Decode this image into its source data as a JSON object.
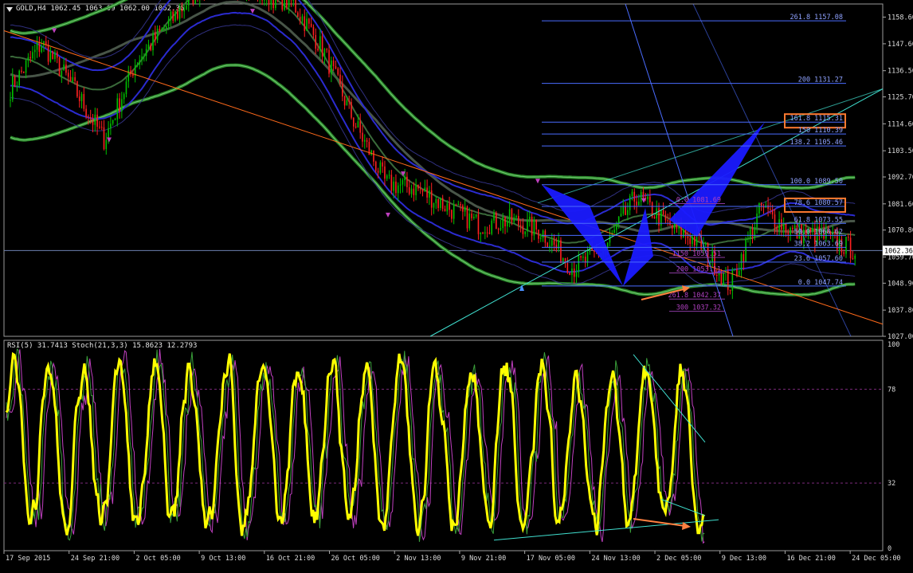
{
  "main_panel": {
    "symbol_header": "GOLD,H4  1062.45 1063.09 1062.00 1062.36",
    "current_price_label": "1062.36",
    "colors": {
      "background": "#000000",
      "bull_candle": "#00c000",
      "bear_candle": "#ff2020",
      "trendline": "#ff6a1a",
      "channel": "#40e0d0",
      "fib": "#4a6cff",
      "pattern": "#1a1aff",
      "ma_outer": "#2a8a2a",
      "band": "#4040ff"
    }
  },
  "fib_levels_upper": [
    {
      "label": "261.8  1157.08",
      "price": 1157.08
    },
    {
      "label": "200  1131.27",
      "price": 1131.27
    },
    {
      "label": "161.8  1115.31",
      "price": 1115.31,
      "highlight": true
    },
    {
      "label": "150  1110.39",
      "price": 1110.39
    },
    {
      "label": "138.2  1105.46",
      "price": 1105.46
    },
    {
      "label": "100.0  1089.50",
      "price": 1089.5
    },
    {
      "label": "78.6  1080.57",
      "price": 1080.57,
      "highlight": true
    },
    {
      "label": "61.8  1073.55",
      "price": 1073.55
    },
    {
      "label": "50.0  1068.62",
      "price": 1068.62
    },
    {
      "label": "38.2  1063.69",
      "price": 1063.69
    },
    {
      "label": "23.6  1057.60",
      "price": 1057.6
    },
    {
      "label": "0.0  1047.74",
      "price": 1047.74
    }
  ],
  "fib_levels_lower": [
    {
      "label": "0.0  1081.69",
      "price": 1081.69
    },
    {
      "label": "1150  1059.51",
      "price": 1059.51
    },
    {
      "label": "200  1053.11",
      "price": 1053.11
    },
    {
      "label": "261.8  1042.37",
      "price": 1042.37
    },
    {
      "label": "300  1037.32",
      "price": 1037.32
    }
  ],
  "rsi_panel": {
    "header": "RSI(5) 31.7413  Stoch(21,3,3) 15.8623 12.2793",
    "levels": [
      "100",
      "78",
      "32",
      "0"
    ],
    "colors": {
      "rsi": "#ffff00",
      "stoch_main": "#3aa03a",
      "stoch_signal": "#c040c0",
      "trend": "#40e0d0",
      "arrow": "#ff8040"
    }
  },
  "chart_data": [
    {
      "type": "candlestick",
      "title": "GOLD,H4",
      "y_ticks": [
        "1158.60",
        "1147.60",
        "1136.50",
        "1125.70",
        "1114.60",
        "1103.50",
        "1092.70",
        "1081.60",
        "1070.80",
        "1059.70",
        "1048.90",
        "1037.80",
        "1027.00"
      ],
      "ylim": [
        1027.0,
        1164.0
      ],
      "current_price": 1062.36,
      "x_ticks": [
        "17 Sep 2015",
        "24 Sep 21:00",
        "2 Oct 05:00",
        "9 Oct 13:00",
        "16 Oct 21:00",
        "26 Oct 05:00",
        "2 Nov 13:00",
        "9 Nov 21:00",
        "17 Nov 05:00",
        "24 Nov 13:00",
        "2 Dec 05:00",
        "9 Dec 13:00",
        "16 Dec 21:00",
        "24 Dec 05:00"
      ],
      "approx_close_path": [
        {
          "t": "17 Sep 2015",
          "y": 1129
        },
        {
          "t": "24 Sep 21:00",
          "y": 1148
        },
        {
          "t": "28 Sep",
          "y": 1130
        },
        {
          "t": "2 Oct 05:00",
          "y": 1108
        },
        {
          "t": "5 Oct",
          "y": 1140
        },
        {
          "t": "9 Oct 13:00",
          "y": 1155
        },
        {
          "t": "14 Oct",
          "y": 1170
        },
        {
          "t": "16 Oct 21:00",
          "y": 1175
        },
        {
          "t": "22 Oct",
          "y": 1168
        },
        {
          "t": "26 Oct 05:00",
          "y": 1165
        },
        {
          "t": "29 Oct",
          "y": 1145
        },
        {
          "t": "2 Nov 13:00",
          "y": 1115
        },
        {
          "t": "6 Nov",
          "y": 1090
        },
        {
          "t": "9 Nov 21:00",
          "y": 1088
        },
        {
          "t": "12 Nov",
          "y": 1080
        },
        {
          "t": "17 Nov 05:00",
          "y": 1073
        },
        {
          "t": "20 Nov",
          "y": 1075
        },
        {
          "t": "24 Nov 13:00",
          "y": 1070
        },
        {
          "t": "30 Nov",
          "y": 1055
        },
        {
          "t": "2 Dec 05:00",
          "y": 1063
        },
        {
          "t": "4 Dec",
          "y": 1085
        },
        {
          "t": "9 Dec 13:00",
          "y": 1073
        },
        {
          "t": "14 Dec",
          "y": 1066
        },
        {
          "t": "16 Dec 21:00",
          "y": 1048
        },
        {
          "t": "18 Dec",
          "y": 1080
        },
        {
          "t": "22 Dec",
          "y": 1070
        },
        {
          "t": "24 Dec 05:00",
          "y": 1068
        },
        {
          "t": "28 Dec",
          "y": 1062.36
        }
      ]
    },
    {
      "type": "line",
      "title": "RSI(5) / Stoch(21,3,3)",
      "y_ticks": [
        "100",
        "78",
        "32",
        "0"
      ],
      "ylim": [
        0,
        100
      ],
      "current": {
        "rsi": 31.7413,
        "stoch_main": 15.8623,
        "stoch_signal": 12.2793
      }
    }
  ]
}
